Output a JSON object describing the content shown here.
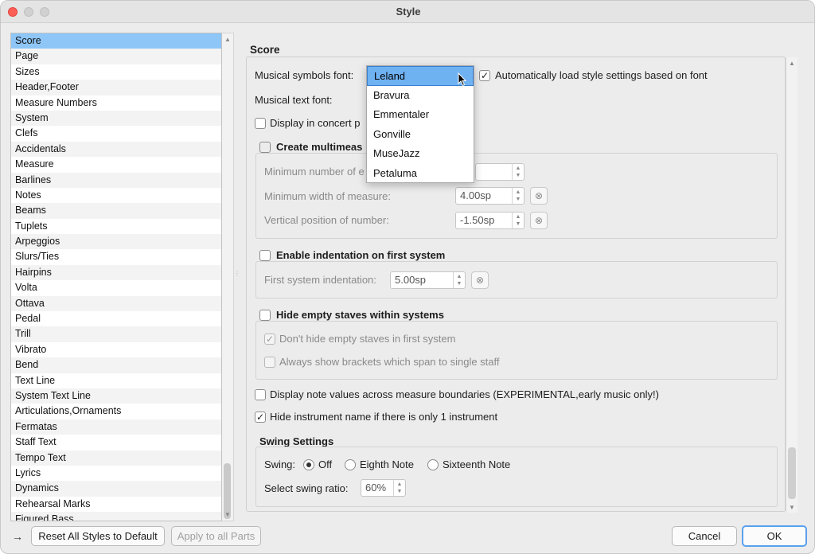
{
  "window": {
    "title": "Style"
  },
  "sidebar": {
    "items": [
      "Score",
      "Page",
      "Sizes",
      "Header,Footer",
      "Measure Numbers",
      "System",
      "Clefs",
      "Accidentals",
      "Measure",
      "Barlines",
      "Notes",
      "Beams",
      "Tuplets",
      "Arpeggios",
      "Slurs/Ties",
      "Hairpins",
      "Volta",
      "Ottava",
      "Pedal",
      "Trill",
      "Vibrato",
      "Bend",
      "Text Line",
      "System Text Line",
      "Articulations,Ornaments",
      "Fermatas",
      "Staff Text",
      "Tempo Text",
      "Lyrics",
      "Dynamics",
      "Rehearsal Marks",
      "Figured Bass"
    ],
    "selected": "Score"
  },
  "main": {
    "heading": "Score",
    "musical_symbols_font_label": "Musical symbols font:",
    "auto_load_label": "Automatically load style settings based on font",
    "musical_text_font_label": "Musical text font:",
    "concert_pitch_label": "Display in concert p",
    "multimeasure_label": "Create multimeas",
    "min_number_label": "Minimum number of e",
    "min_width_label": "Minimum width of measure:",
    "min_width_value": "4.00sp",
    "vertical_pos_label": "Vertical position of number:",
    "vertical_pos_value": "-1.50sp",
    "indentation_label": "Enable indentation on first system",
    "first_indent_label": "First system indentation:",
    "first_indent_value": "5.00sp",
    "hide_empty_label": "Hide empty staves within systems",
    "dont_hide_label": "Don't hide empty staves in first system",
    "always_show_label": "Always show brackets which span to single staff",
    "note_values_label": "Display note values across measure boundaries (EXPERIMENTAL,early music only!)",
    "hide_instr_label": "Hide instrument name if there is only 1 instrument",
    "swing_heading": "Swing Settings",
    "swing_label": "Swing:",
    "swing_off": "Off",
    "swing_eighth": "Eighth Note",
    "swing_sixteenth": "Sixteenth Note",
    "swing_ratio_label": "Select swing ratio:",
    "swing_ratio_value": "60%"
  },
  "dropdown": {
    "options": [
      "Leland",
      "Bravura",
      "Emmentaler",
      "Gonville",
      "MuseJazz",
      "Petaluma"
    ],
    "selected": "Leland"
  },
  "buttons": {
    "reset_all": "Reset All Styles to Default",
    "apply_parts": "Apply to all Parts",
    "cancel": "Cancel",
    "ok": "OK"
  },
  "colors": {
    "selection": "#8ec6f7",
    "accent": "#5aa0ee",
    "close": "#fe5f57"
  }
}
